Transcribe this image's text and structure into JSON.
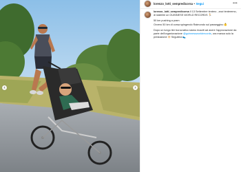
{
  "post": {
    "username": "lorenzo_lotti_sempredicorsa",
    "separator": "•",
    "follow_label": "Segui",
    "more_icon": "more-options-icon",
    "caption": {
      "username": "lorenzo_lotti_sempredicorsa",
      "intro": "Il 13 Settembre tentero , anzi tenteremo, di stabilire un GUINNESS WORLD RECORDS",
      "intro_emoji": "🏃",
      "line2": "50 km pushing a pram",
      "line3": "Ovvero 50 km di corsa spingendo Raimondo sul passeggino",
      "line3_emoji": "👶",
      "line4_start": "Dopo un lungo iter burocratico siamo riusciti ad avere l'approvazione da parte dell'organizzazione",
      "mention": "@guinnessworldrecords",
      "line4_end": ", ora manca solo la prestazione",
      "line4_emoji": "😅",
      "line5": "Seguiteci",
      "line5_emoji": "👟"
    }
  },
  "colors": {
    "link": "#0095f6",
    "text": "#262626"
  }
}
